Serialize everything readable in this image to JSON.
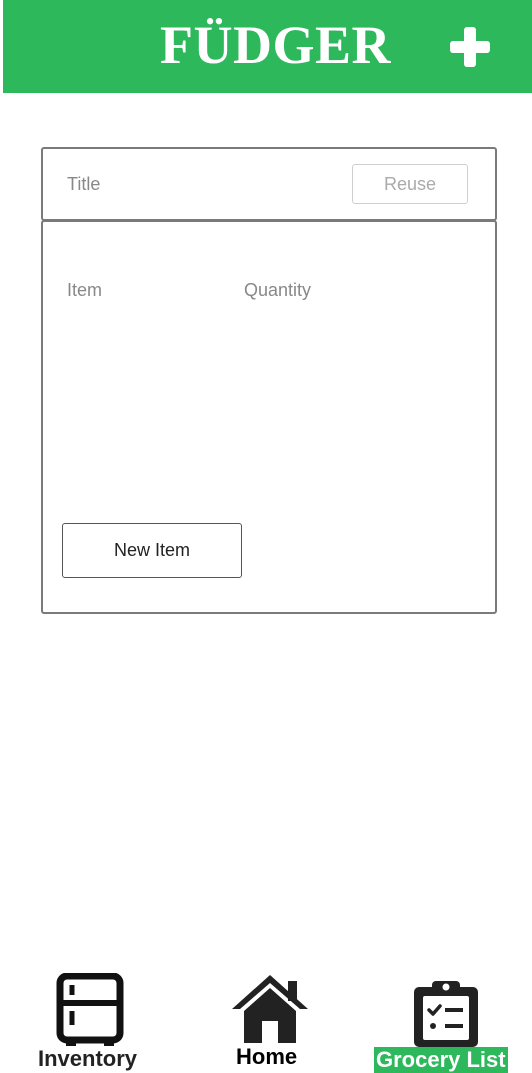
{
  "header": {
    "app_name": "FÜDGER",
    "add_icon": "plus-icon",
    "bg_color": "#2db85c"
  },
  "list_form": {
    "title_placeholder": "Title",
    "title_value": "",
    "reuse_label": "Reuse",
    "item_placeholder": "Item",
    "quantity_placeholder": "Quantity",
    "new_item_label": "New Item"
  },
  "bottom_nav": {
    "items": [
      {
        "label": "Inventory",
        "icon": "fridge-icon"
      },
      {
        "label": "Home",
        "icon": "house-icon"
      },
      {
        "label": "Grocery List",
        "icon": "clipboard-list-icon",
        "active": true
      }
    ],
    "active_color": "#2db85c"
  }
}
